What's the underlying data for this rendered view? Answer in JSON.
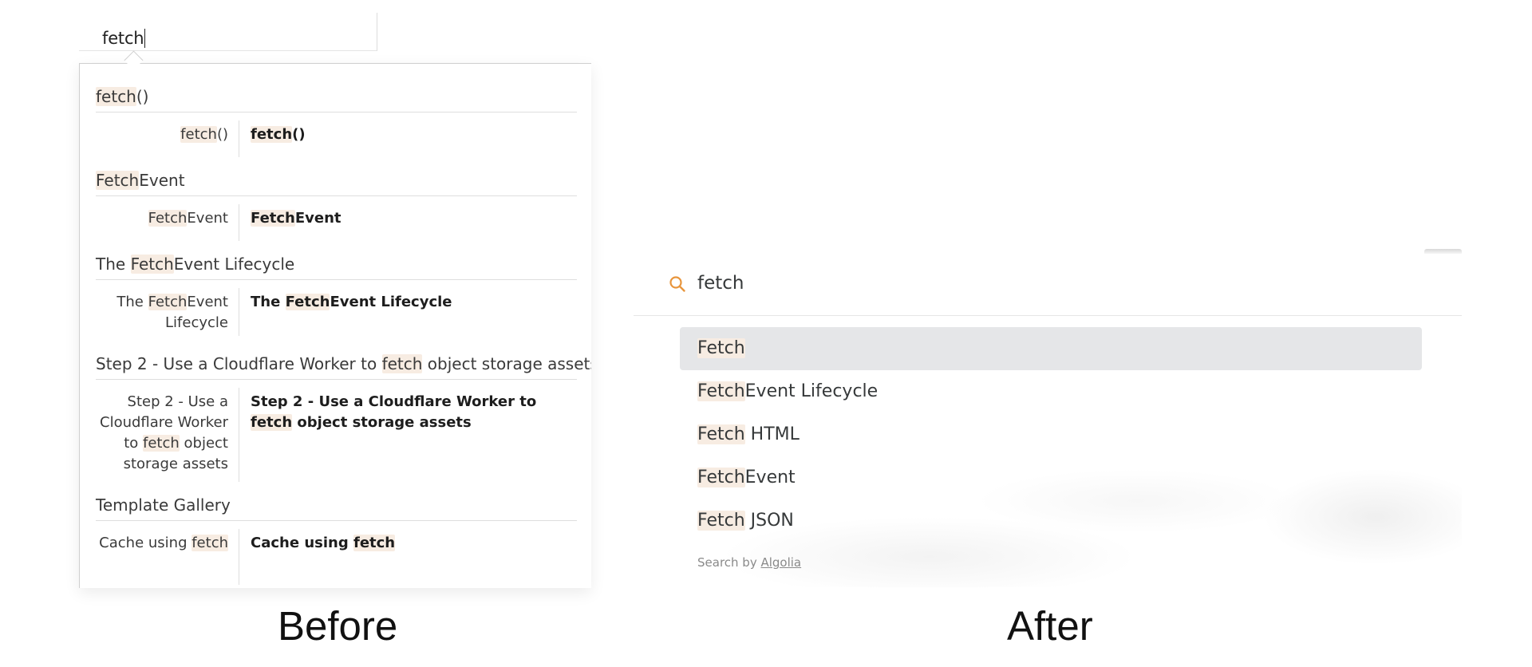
{
  "before": {
    "label": "Before",
    "input_value": "fetch",
    "groups": [
      {
        "title": [
          {
            "t": "fetch",
            "hl": true
          },
          {
            "t": "()",
            "hl": false
          }
        ],
        "left": [
          {
            "t": "fetch",
            "hl": true
          },
          {
            "t": "()",
            "hl": false
          }
        ],
        "right": [
          {
            "t": "fetch",
            "hl": true
          },
          {
            "t": "()",
            "hl": false
          }
        ]
      },
      {
        "title": [
          {
            "t": "Fetch",
            "hl": true
          },
          {
            "t": "Event",
            "hl": false
          }
        ],
        "left": [
          {
            "t": "Fetch",
            "hl": true
          },
          {
            "t": "Event",
            "hl": false
          }
        ],
        "right": [
          {
            "t": "Fetch",
            "hl": true
          },
          {
            "t": "Event",
            "hl": false
          }
        ]
      },
      {
        "title": [
          {
            "t": "The ",
            "hl": false
          },
          {
            "t": "Fetch",
            "hl": true
          },
          {
            "t": "Event Lifecycle",
            "hl": false
          }
        ],
        "left": [
          {
            "t": "The ",
            "hl": false
          },
          {
            "t": "Fetch",
            "hl": true
          },
          {
            "t": "Event Lifecycle",
            "hl": false
          }
        ],
        "right": [
          {
            "t": "The ",
            "hl": false
          },
          {
            "t": "Fetch",
            "hl": true
          },
          {
            "t": "Event Lifecycle",
            "hl": false
          }
        ]
      },
      {
        "title": [
          {
            "t": "Step 2 - Use a Cloudflare Worker to ",
            "hl": false
          },
          {
            "t": "fetch",
            "hl": true
          },
          {
            "t": " object storage assets",
            "hl": false
          }
        ],
        "left": [
          {
            "t": "Step 2 - Use a Cloudflare Worker to ",
            "hl": false
          },
          {
            "t": "fetch",
            "hl": true
          },
          {
            "t": " object storage assets",
            "hl": false
          }
        ],
        "right": [
          {
            "t": "Step 2 - Use a Cloudflare Worker to ",
            "hl": false
          },
          {
            "t": "fetch",
            "hl": true
          },
          {
            "t": " object storage assets",
            "hl": false
          }
        ]
      },
      {
        "title": [
          {
            "t": "Template Gallery",
            "hl": false
          }
        ],
        "left": [
          {
            "t": "Cache using ",
            "hl": false
          },
          {
            "t": "fetch",
            "hl": true
          }
        ],
        "right": [
          {
            "t": "Cache using ",
            "hl": false
          },
          {
            "t": "fetch",
            "hl": true
          }
        ]
      }
    ]
  },
  "after": {
    "label": "After",
    "input_value": "fetch",
    "results": [
      [
        {
          "t": "Fetch",
          "hl": true
        }
      ],
      [
        {
          "t": "Fetch",
          "hl": true
        },
        {
          "t": "Event Lifecycle",
          "hl": false
        }
      ],
      [
        {
          "t": "Fetch",
          "hl": true
        },
        {
          "t": " HTML",
          "hl": false
        }
      ],
      [
        {
          "t": "Fetch",
          "hl": true
        },
        {
          "t": "Event",
          "hl": false
        }
      ],
      [
        {
          "t": "Fetch",
          "hl": true
        },
        {
          "t": " JSON",
          "hl": false
        }
      ]
    ],
    "footer_prefix": "Search by ",
    "footer_link": "Algolia",
    "colors": {
      "search_icon": "#e8953c",
      "highlight": "#f7ece2",
      "active_row": "#e5e6e8"
    }
  }
}
